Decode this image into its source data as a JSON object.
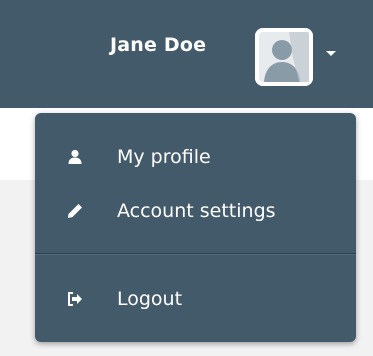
{
  "header": {
    "user_name": "Jane Doe",
    "avatar_icon": "user-silhouette-icon",
    "caret_icon": "caret-down-icon",
    "background_color": "#435a6b"
  },
  "dropdown": {
    "background_color": "#435a6b",
    "items": [
      {
        "label": "My profile",
        "icon": "user-icon"
      },
      {
        "label": "Account settings",
        "icon": "pencil-icon"
      },
      {
        "label": "Logout",
        "icon": "sign-out-icon"
      }
    ]
  }
}
